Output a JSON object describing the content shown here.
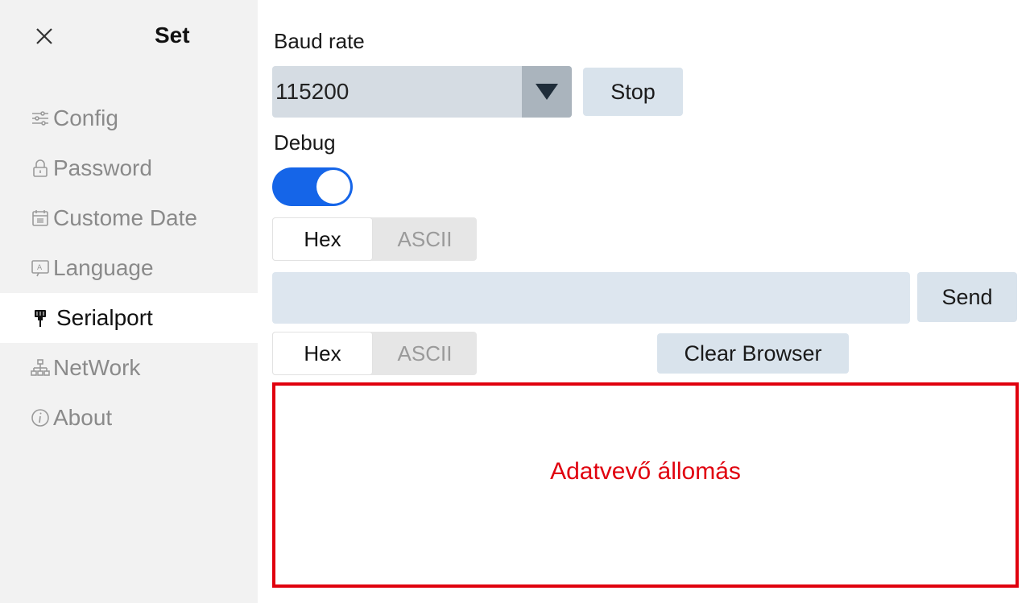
{
  "sidebar": {
    "title": "Set",
    "items": [
      {
        "label": "Config",
        "icon": "sliders-icon"
      },
      {
        "label": "Password",
        "icon": "lock-icon"
      },
      {
        "label": "Custome Date",
        "icon": "calendar-icon"
      },
      {
        "label": "Language",
        "icon": "language-icon"
      },
      {
        "label": "Serialport",
        "icon": "plug-icon",
        "active": true
      },
      {
        "label": "NetWork",
        "icon": "network-icon"
      },
      {
        "label": "About",
        "icon": "info-icon"
      }
    ]
  },
  "main": {
    "baud_label": "Baud rate",
    "baud_value": "115200",
    "stop_label": "Stop",
    "debug_label": "Debug",
    "debug_on": true,
    "send_format": {
      "options": [
        "Hex",
        "ASCII"
      ],
      "selected": "Hex"
    },
    "send_label": "Send",
    "receive_format": {
      "options": [
        "Hex",
        "ASCII"
      ],
      "selected": "Hex"
    },
    "clear_label": "Clear Browser",
    "browser_text": "Adatvevő állomás"
  },
  "colors": {
    "accent": "#1565e8",
    "highlight": "#e0000e"
  }
}
